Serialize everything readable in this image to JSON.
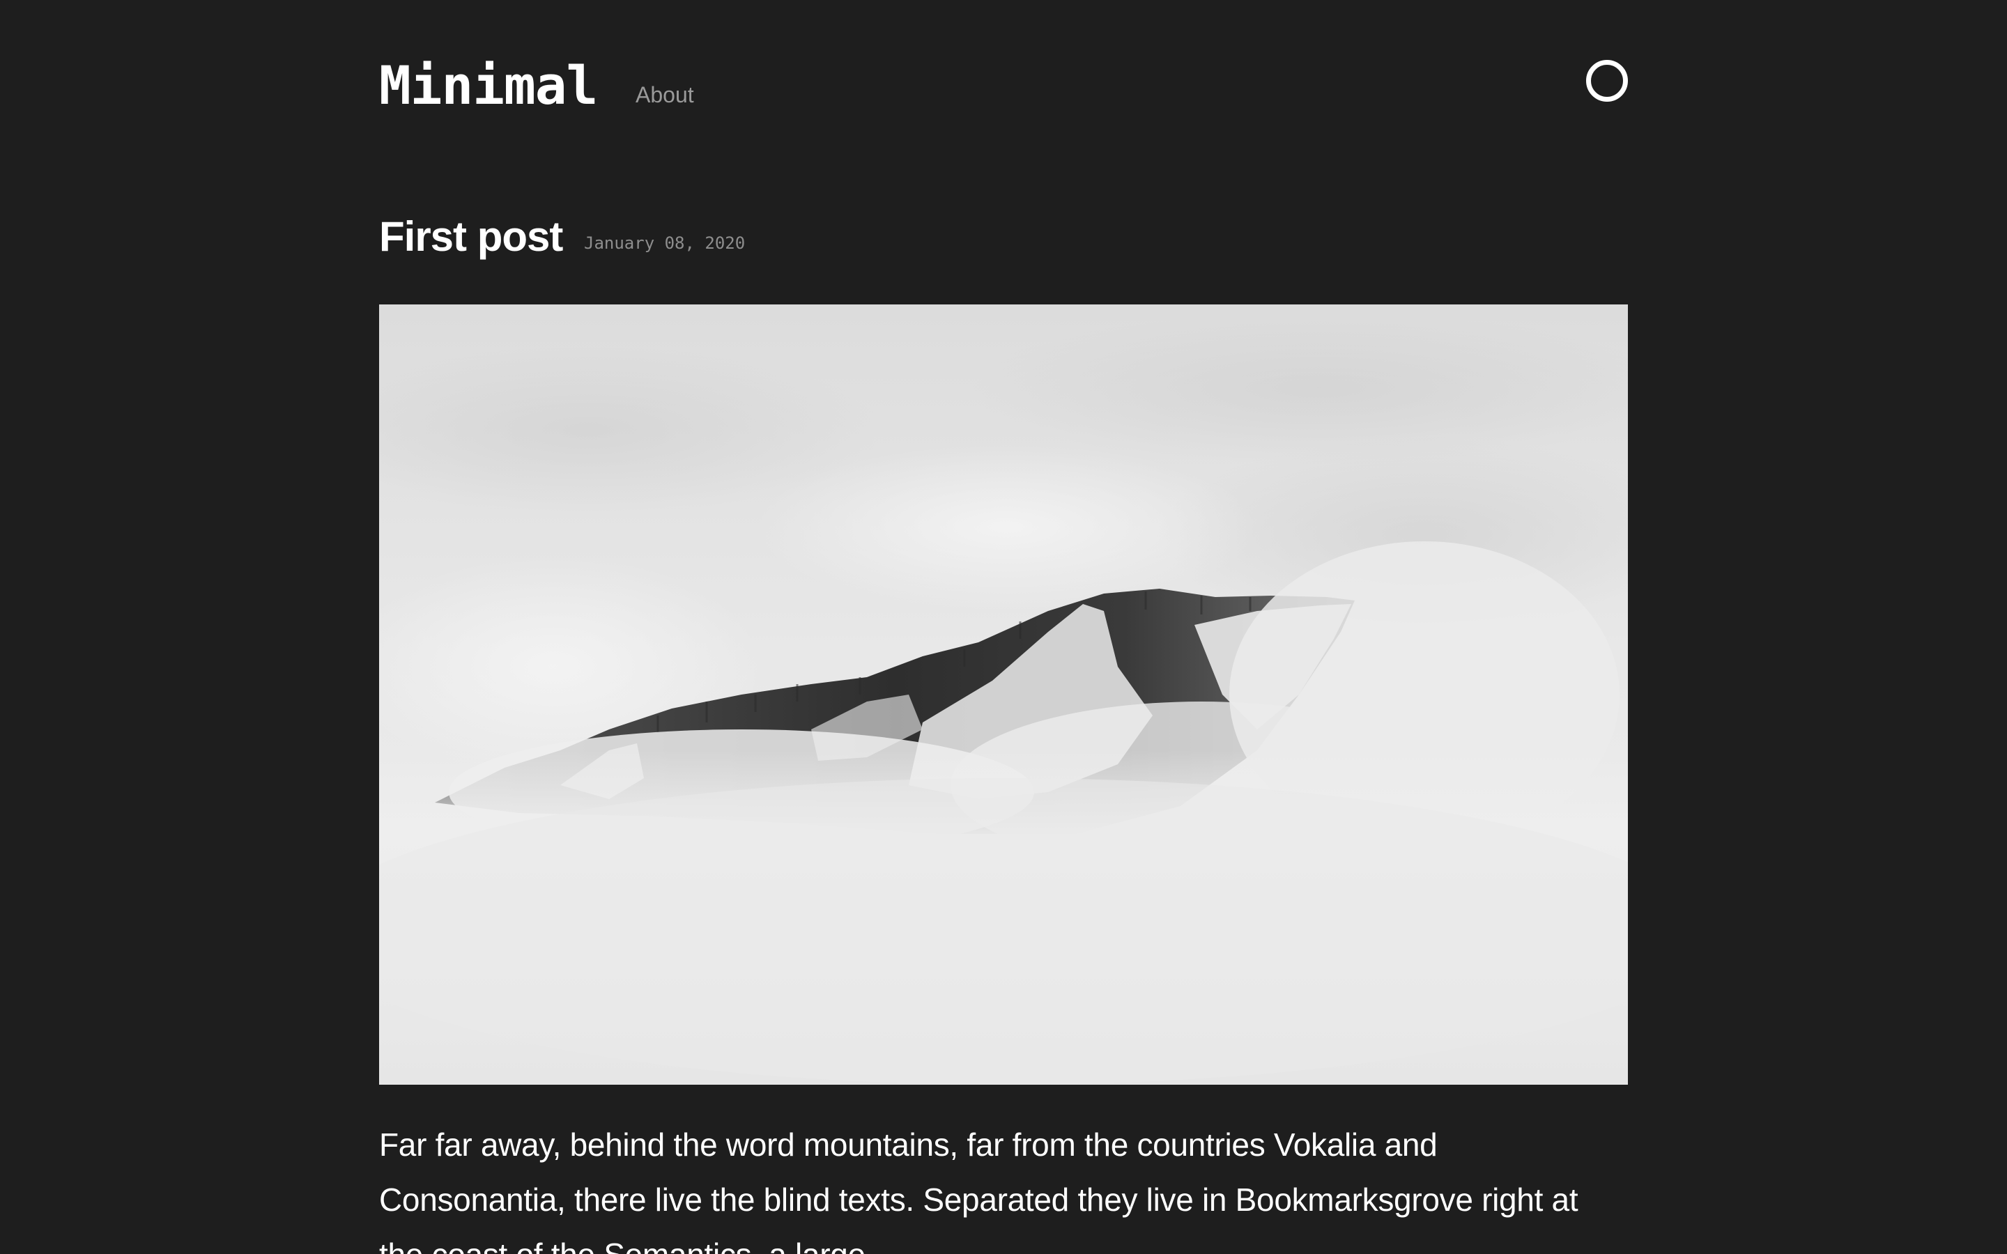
{
  "header": {
    "site_title": "Minimal",
    "nav": [
      {
        "label": "About"
      }
    ],
    "theme_toggle_icon": "circle-toggle-icon"
  },
  "post": {
    "title": "First post",
    "date": "January 08, 2020",
    "hero_image": "snowy-mountain-in-fog-photo",
    "body": "Far far away, behind the word mountains, far from the countries Vokalia and Consonantia, there live the blind texts. Separated they live in Bookmarksgrove right at the coast of the Semantics, a large"
  },
  "colors": {
    "background": "#1e1e1e",
    "text": "#ffffff",
    "muted_text": "#9a9a9a",
    "date_text": "#8e8e8e"
  }
}
